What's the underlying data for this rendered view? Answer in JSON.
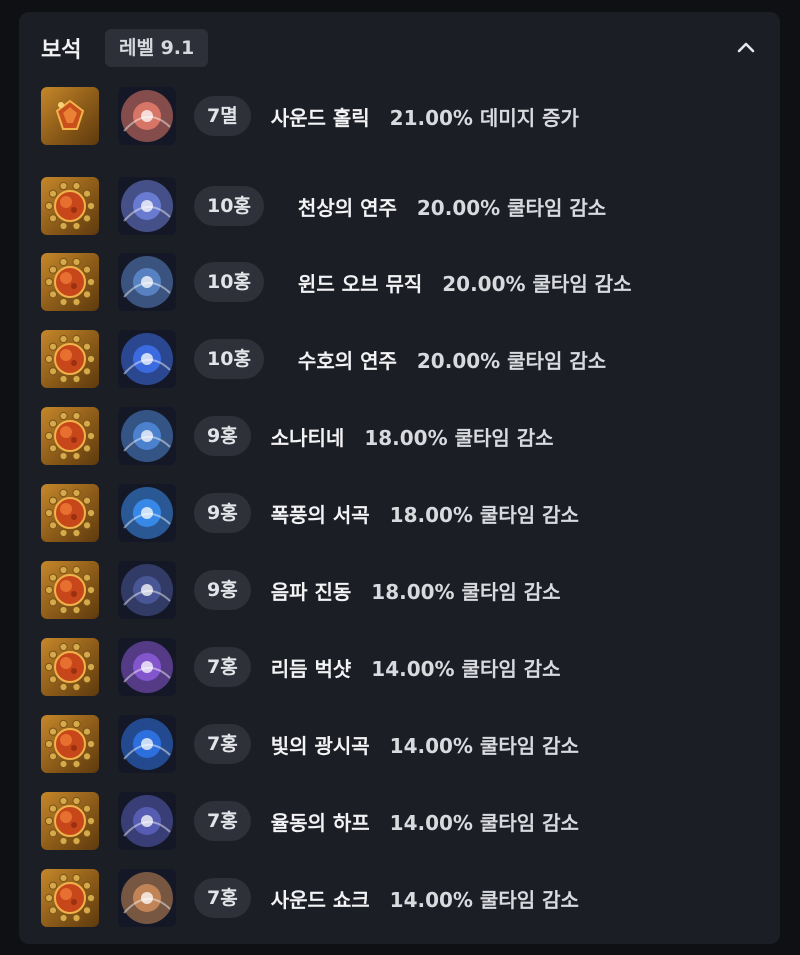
{
  "header": {
    "title": "보석",
    "level": "레벨 9.1"
  },
  "gems": [
    {
      "grade": "7멸",
      "skill": "사운드 홀릭",
      "effect": "21.00% 데미지 증가",
      "gem_type": "damage",
      "skill_color": "#e07a6a"
    },
    {
      "grade": "10홍",
      "skill": "천상의 연주",
      "effect": "20.00% 쿨타임 감소",
      "gem_type": "cooldown",
      "skill_color": "#6d7fd8"
    },
    {
      "grade": "10홍",
      "skill": "윈드 오브 뮤직",
      "effect": "20.00% 쿨타임 감소",
      "gem_type": "cooldown",
      "skill_color": "#5b86c9"
    },
    {
      "grade": "10홍",
      "skill": "수호의 연주",
      "effect": "20.00% 쿨타임 감소",
      "gem_type": "cooldown",
      "skill_color": "#3d6fe8"
    },
    {
      "grade": "9홍",
      "skill": "소나티네",
      "effect": "18.00% 쿨타임 감소",
      "gem_type": "cooldown",
      "skill_color": "#4f86d6"
    },
    {
      "grade": "9홍",
      "skill": "폭풍의 서곡",
      "effect": "18.00% 쿨타임 감소",
      "gem_type": "cooldown",
      "skill_color": "#3a8ef0"
    },
    {
      "grade": "9홍",
      "skill": "음파 진동",
      "effect": "18.00% 쿨타임 감소",
      "gem_type": "cooldown",
      "skill_color": "#4a5a9a"
    },
    {
      "grade": "7홍",
      "skill": "리듬 벅샷",
      "effect": "14.00% 쿨타임 감소",
      "gem_type": "cooldown",
      "skill_color": "#8a5ad6"
    },
    {
      "grade": "7홍",
      "skill": "빛의 광시곡",
      "effect": "14.00% 쿨타임 감소",
      "gem_type": "cooldown",
      "skill_color": "#2f74e6"
    },
    {
      "grade": "7홍",
      "skill": "율동의 하프",
      "effect": "14.00% 쿨타임 감소",
      "gem_type": "cooldown",
      "skill_color": "#5a5fb8"
    },
    {
      "grade": "7홍",
      "skill": "사운드 쇼크",
      "effect": "14.00% 쿨타임 감소",
      "gem_type": "cooldown",
      "skill_color": "#c98a5a"
    }
  ],
  "colors": {
    "panel_bg": "#1c1e25",
    "badge_bg": "#2e313a",
    "gem_gold": "#c6872a",
    "gem_core": "#d9531e"
  }
}
